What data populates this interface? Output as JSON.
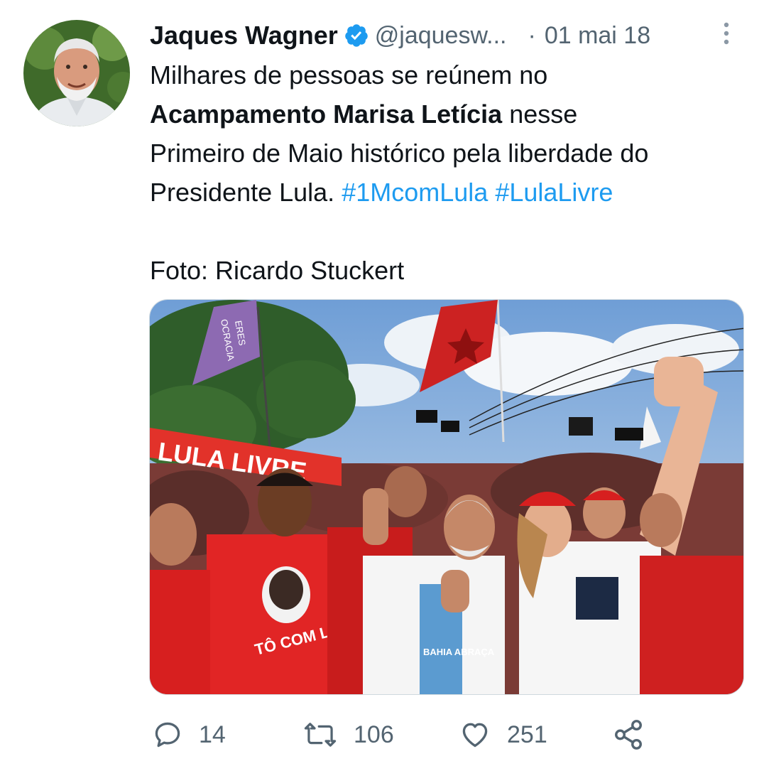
{
  "author": {
    "name": "Jaques Wagner",
    "handle": "@jaquesw...",
    "separator": "·",
    "date": "01 mai 18"
  },
  "tweet": {
    "line1": "Milhares de pessoas se reúnem no",
    "bold": "Acampamento Marisa Letícia",
    "after_bold": " nesse",
    "line3": "Primeiro de Maio histórico pela liberdade do",
    "line4_start": "Presidente Lula. ",
    "hashtag1": "#1McomLula",
    "hashtag_space": " ",
    "hashtag2": "#LulaLivre",
    "credit": "Foto: Ricardo Stuckert"
  },
  "photo": {
    "banner_text": "LULA LIVRE",
    "flag_text_1": "ERES",
    "flag_text_2": "OCRACIA",
    "shirt_text": "TÔ COM LULA",
    "shirt_text_2": "BAHIA ABRAÇA"
  },
  "actions": {
    "replies": "14",
    "retweets": "106",
    "likes": "251"
  },
  "colors": {
    "link": "#1d9bf0",
    "secondary": "#536471",
    "verified": "#1d9bf0"
  },
  "icons": {
    "reply": "speech-bubble-icon",
    "retweet": "retweet-arrows-icon",
    "like": "heart-icon",
    "share": "share-nodes-icon",
    "more": "vertical-dots-icon",
    "verified": "verified-badge-icon"
  }
}
